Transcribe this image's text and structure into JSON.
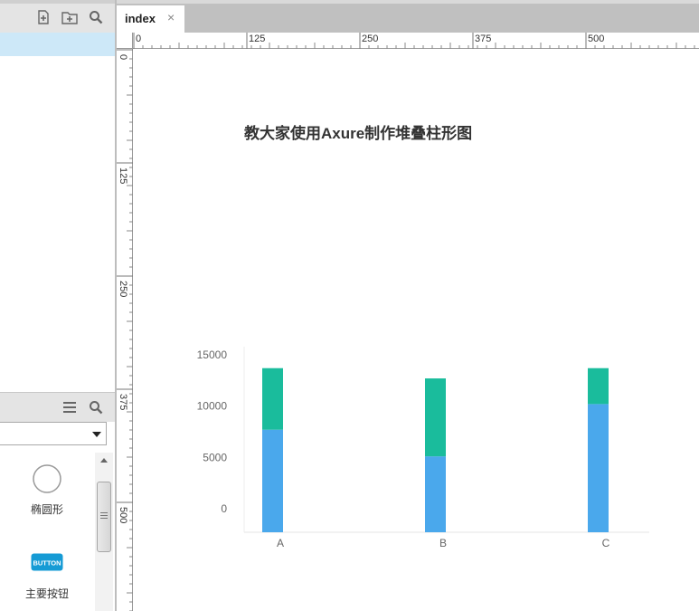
{
  "left_pane": {
    "pages_toolbar": {
      "icons": [
        "add-page-icon",
        "add-folder-icon",
        "search-icon"
      ]
    },
    "widgets_toolbar": {
      "icons": [
        "menu-icon",
        "search-icon"
      ]
    },
    "widgets": [
      {
        "label": "椭圆形",
        "icon": "ellipse-icon"
      },
      {
        "label": "主要按钮",
        "icon": "button-icon",
        "icon_text": "BUTTON"
      }
    ]
  },
  "tabs": [
    {
      "label": "index",
      "close": "×"
    }
  ],
  "ruler": {
    "top_labels": [
      "0",
      "125",
      "250",
      "375",
      "500"
    ],
    "left_labels": [
      "0",
      "125",
      "250",
      "375",
      "500"
    ]
  },
  "page": {
    "title": "教大家使用Axure制作堆叠柱形图"
  },
  "colors": {
    "series_blue": "#4aa8ec",
    "series_green": "#1abc9c",
    "selected_row": "#cde8f8"
  },
  "chart_data": {
    "type": "bar",
    "stacked": true,
    "categories": [
      "A",
      "B",
      "C"
    ],
    "series": [
      {
        "values": [
          10000,
          7400,
          12500
        ],
        "color": "#4aa8ec"
      },
      {
        "values": [
          6000,
          7600,
          3500
        ],
        "color": "#1abc9c"
      }
    ],
    "y_ticks": [
      "15000",
      "10000",
      "5000",
      "0"
    ],
    "ylim": [
      -2300,
      16500
    ],
    "grid": false
  }
}
